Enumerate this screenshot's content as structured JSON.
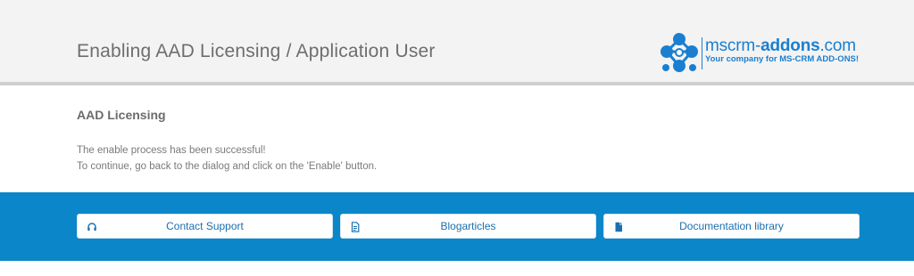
{
  "header": {
    "title": "Enabling AAD Licensing / Application User",
    "logo": {
      "brand_prefix": "mscrm-",
      "brand_bold": "addons",
      "brand_suffix": ".com",
      "tagline": "Your company for MS-CRM ADD-ONS!",
      "color": "#1a7fd0"
    }
  },
  "main": {
    "section_title": "AAD Licensing",
    "message_lines": [
      "The enable process has been successful!",
      "To continue, go back to the dialog and click on the 'Enable' button."
    ]
  },
  "footer": {
    "band_color": "#0a86c9",
    "links": [
      {
        "label": "Contact Support",
        "icon": "headset-icon"
      },
      {
        "label": "Blogarticles",
        "icon": "blog-document-icon"
      },
      {
        "label": "Documentation library",
        "icon": "document-icon"
      }
    ]
  }
}
